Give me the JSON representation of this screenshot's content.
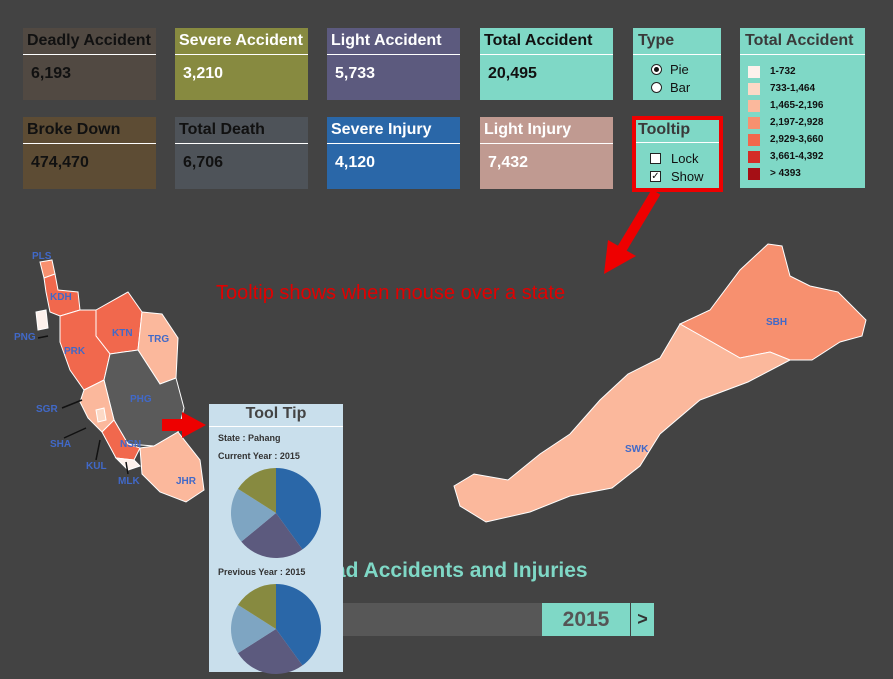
{
  "kpis": [
    {
      "label": "Deadly Accident",
      "value": "6,193",
      "bg": "#514942",
      "header": "#514942",
      "text": "dark"
    },
    {
      "label": "Severe Accident",
      "value": "3,210",
      "bg": "#878a40",
      "text": "light"
    },
    {
      "label": "Light Accident",
      "value": "5,733",
      "bg": "#5c5a7e",
      "text": "light"
    },
    {
      "label": "Total Accident",
      "value": "20,495",
      "bg": "#7fd8c6",
      "text": "dark"
    },
    {
      "label": "Broke Down",
      "value": "474,470",
      "bg": "#5d4c34",
      "text": "dark"
    },
    {
      "label": "Total Death",
      "value": "6,706",
      "bg": "#4e5359",
      "text": "dark"
    },
    {
      "label": "Severe Injury",
      "value": "4,120",
      "bg": "#2a67a8",
      "text": "light"
    },
    {
      "label": "Light Injury",
      "value": "7,432",
      "bg": "#c09a91",
      "text": "light"
    }
  ],
  "type_panel": {
    "title": "Type",
    "options": [
      "Pie",
      "Bar"
    ],
    "selected": "Pie"
  },
  "tooltip_panel": {
    "title": "Tooltip",
    "options": [
      {
        "label": "Lock",
        "checked": false
      },
      {
        "label": "Show",
        "checked": true
      }
    ]
  },
  "legend": {
    "title": "Total Accident",
    "items": [
      {
        "label": "1-732",
        "color": "#fdf1ec"
      },
      {
        "label": "733-1,464",
        "color": "#fcd9c6"
      },
      {
        "label": "1,465-2,196",
        "color": "#fbb89c"
      },
      {
        "label": "2,197-2,928",
        "color": "#f7906f"
      },
      {
        "label": "2,929-3,660",
        "color": "#f1684d"
      },
      {
        "label": "3,661-4,392",
        "color": "#d42d27"
      },
      {
        "label": "> 4393",
        "color": "#a50f15"
      }
    ]
  },
  "annotation": "Tooltip shows when mouse over a state",
  "states": [
    "PLS",
    "KDH",
    "PNG",
    "KTN",
    "TRG",
    "PRK",
    "PHG",
    "SGR",
    "SHA",
    "NSN",
    "KUL",
    "MLK",
    "JHR",
    "SBH",
    "SWK"
  ],
  "tooltip": {
    "title": "Tool Tip",
    "state": "State : Pahang",
    "current": "Current Year : 2015",
    "previous": "Previous Year : 2015",
    "pie_colors": [
      "#2a67a8",
      "#5c5a7e",
      "#7ea5c2",
      "#878a40"
    ],
    "current_values": [
      40,
      24,
      20,
      16
    ],
    "previous_values": [
      40,
      26,
      18,
      16
    ]
  },
  "footer": {
    "title": "Road Accidents and Injuries",
    "year": "2015",
    "next": ">"
  }
}
